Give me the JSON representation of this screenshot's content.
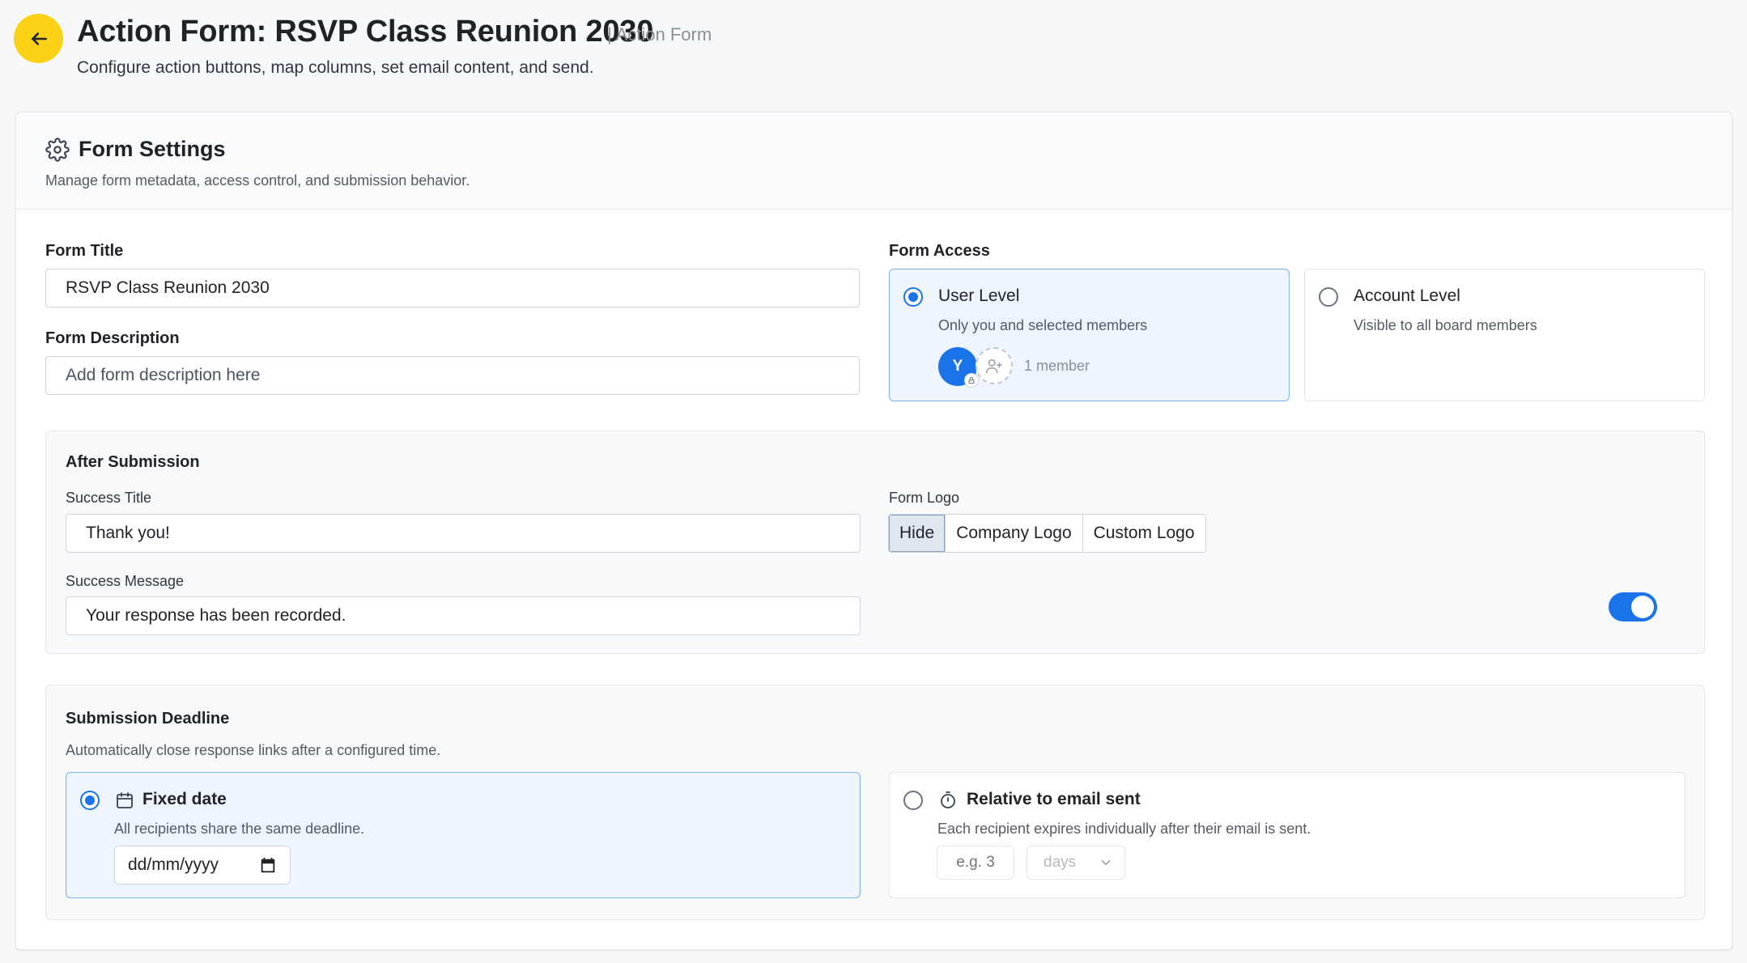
{
  "header": {
    "title": "Action Form: RSVP Class Reunion 2030",
    "tag": "| Action Form",
    "subtitle": "Configure action buttons, map columns, set email content, and send.",
    "accent_color": "#fcd116"
  },
  "form_settings": {
    "title": "Form Settings",
    "description": "Manage form metadata, access control, and submission behavior.",
    "form_title_label": "Form Title",
    "form_title_value": "RSVP Class Reunion 2030",
    "form_description_label": "Form Description",
    "form_description_placeholder": "Add form description here",
    "form_access_label": "Form Access",
    "access_options": [
      {
        "title": "User Level",
        "description": "Only you and selected members",
        "selected": true
      },
      {
        "title": "Account Level",
        "description": "Visible to all board members",
        "selected": false
      }
    ],
    "member_avatar_initial": "Y",
    "member_count": "1 member"
  },
  "after_submission": {
    "title": "After Submission",
    "success_title_label": "Success Title",
    "success_title_value": "Thank you!",
    "success_message_label": "Success Message",
    "success_message_value": "Your response has been recorded.",
    "form_logo_label": "Form Logo",
    "logo_options": [
      "Hide",
      "Company Logo",
      "Custom Logo"
    ],
    "logo_selected": "Hide"
  },
  "submission_deadline": {
    "title": "Submission Deadline",
    "description": "Automatically close response links after a configured time.",
    "enabled": true,
    "fixed": {
      "title": "Fixed date",
      "description": "All recipients share the same deadline.",
      "date_placeholder": "dd/mm/yyyy",
      "selected": true
    },
    "relative": {
      "title": "Relative to email sent",
      "description": "Each recipient expires individually after their email is sent.",
      "amount_placeholder": "e.g. 3",
      "unit": "days",
      "selected": false
    }
  },
  "colors": {
    "primary": "#1a73e8",
    "selected_bg": "#eef5fe"
  }
}
